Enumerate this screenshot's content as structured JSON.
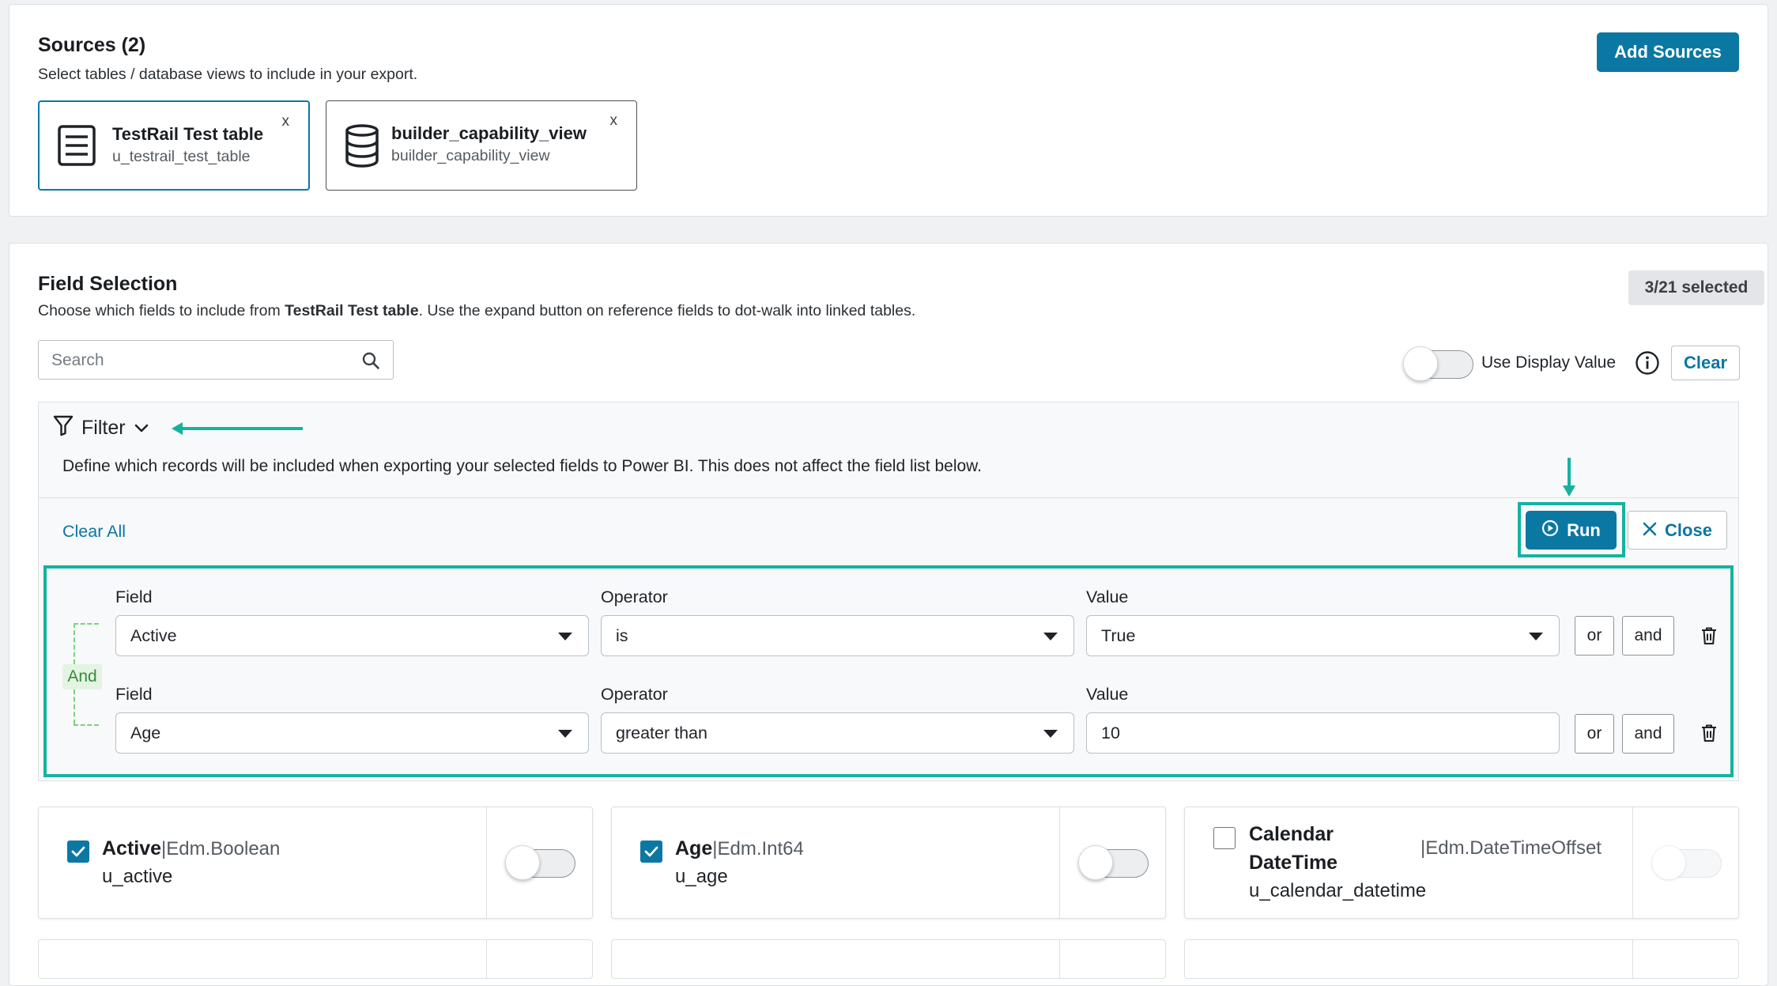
{
  "sources": {
    "title": "Sources (2)",
    "subtitle": "Select tables / database views to include in your export.",
    "add_button": "Add Sources",
    "items": [
      {
        "title": "TestRail Test table",
        "subtitle": "u_testrail_test_table",
        "remove": "x",
        "icon": "table-icon"
      },
      {
        "title": "builder_capability_view",
        "subtitle": "builder_capability_view",
        "remove": "x",
        "icon": "database-icon"
      }
    ]
  },
  "fields": {
    "title": "Field Selection",
    "desc_prefix": "Choose which fields to include from ",
    "desc_table": "TestRail Test table",
    "desc_suffix": ". Use the expand button on reference fields to dot-walk into linked tables.",
    "badge": "3/21 selected",
    "search_placeholder": "Search",
    "display_value_label": "Use Display Value",
    "clear_label": "Clear"
  },
  "filter": {
    "label": "Filter",
    "description": "Define which records will be included when exporting your selected fields to Power BI. This does not affect the field list below.",
    "clear_all": "Clear All",
    "run": "Run",
    "close": "Close",
    "group_operator": "And",
    "conditions": [
      {
        "field_label": "Field",
        "field": "Active",
        "operator_label": "Operator",
        "operator": "is",
        "value_label": "Value",
        "value": "True",
        "value_is_select": true,
        "or": "or",
        "and": "and"
      },
      {
        "field_label": "Field",
        "field": "Age",
        "operator_label": "Operator",
        "operator": "greater than",
        "value_label": "Value",
        "value": "10",
        "value_is_select": false,
        "or": "or",
        "and": "and"
      }
    ]
  },
  "field_cards": [
    {
      "name": "Active",
      "sep": "|",
      "type": "Edm.Boolean",
      "column": "u_active",
      "checked": true
    },
    {
      "name": "Age",
      "sep": "|",
      "type": "Edm.Int64",
      "column": "u_age",
      "checked": true
    },
    {
      "name_line1": "Calendar",
      "name_line2": "DateTime",
      "sep": "|",
      "type": "Edm.DateTimeOffset",
      "column": "u_calendar_datetime",
      "checked": false
    }
  ],
  "colors": {
    "accent": "#0b78a3",
    "highlight": "#14b3a0",
    "and_tag": "#e3f4e3"
  }
}
